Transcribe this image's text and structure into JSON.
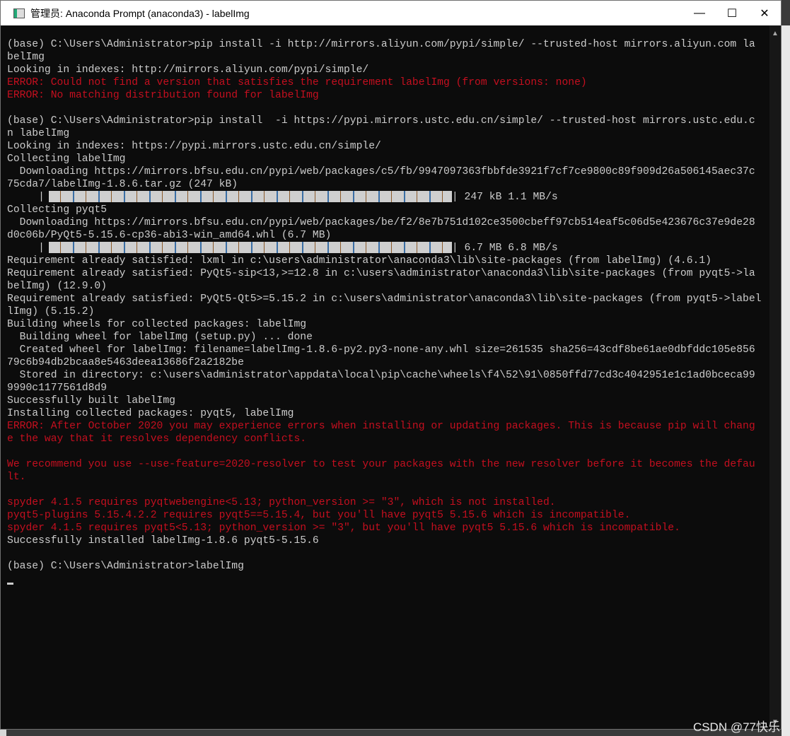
{
  "window": {
    "title": "管理员: Anaconda Prompt (anaconda3) - labelImg",
    "minimize": "—",
    "maximize": "☐",
    "close": "✕"
  },
  "colors": {
    "background": "#0c0c0c",
    "text": "#cccccc",
    "error": "#c50f1f"
  },
  "terminal": {
    "lines": [
      {
        "text": "(base) C:\\Users\\Administrator>pip install -i http://mirrors.aliyun.com/pypi/simple/ --trusted-host mirrors.aliyun.com la"
      },
      {
        "text": "belImg"
      },
      {
        "text": "Looking in indexes: http://mirrors.aliyun.com/pypi/simple/"
      },
      {
        "text": "ERROR: Could not find a version that satisfies the requirement labelImg (from versions: none)",
        "error": true
      },
      {
        "text": "ERROR: No matching distribution found for labelImg",
        "error": true
      },
      {
        "text": ""
      },
      {
        "text": "(base) C:\\Users\\Administrator>pip install  -i https://pypi.mirrors.ustc.edu.cn/simple/ --trusted-host mirrors.ustc.edu.c"
      },
      {
        "text": "n labelImg"
      },
      {
        "text": "Looking in indexes: https://pypi.mirrors.ustc.edu.cn/simple/"
      },
      {
        "text": "Collecting labelImg"
      },
      {
        "text": "  Downloading https://mirrors.bfsu.edu.cn/pypi/web/packages/c5/fb/9947097363fbbfde3921f7cf7ce9800c89f909d26a506145aec37c"
      },
      {
        "text": "75cda7/labelImg-1.8.6.tar.gz (247 kB)"
      },
      {
        "progress": 100,
        "text": "| 247 kB 1.1 MB/s"
      },
      {
        "text": "Collecting pyqt5"
      },
      {
        "text": "  Downloading https://mirrors.bfsu.edu.cn/pypi/web/packages/be/f2/8e7b751d102ce3500cbeff97cb514eaf5c06d5e423676c37e9de28"
      },
      {
        "text": "d0c06b/PyQt5-5.15.6-cp36-abi3-win_amd64.whl (6.7 MB)"
      },
      {
        "progress": 100,
        "text": "| 6.7 MB 6.8 MB/s"
      },
      {
        "text": "Requirement already satisfied: lxml in c:\\users\\administrator\\anaconda3\\lib\\site-packages (from labelImg) (4.6.1)"
      },
      {
        "text": "Requirement already satisfied: PyQt5-sip<13,>=12.8 in c:\\users\\administrator\\anaconda3\\lib\\site-packages (from pyqt5->la"
      },
      {
        "text": "belImg) (12.9.0)"
      },
      {
        "text": "Requirement already satisfied: PyQt5-Qt5>=5.15.2 in c:\\users\\administrator\\anaconda3\\lib\\site-packages (from pyqt5->label"
      },
      {
        "text": "lImg) (5.15.2)"
      },
      {
        "text": "Building wheels for collected packages: labelImg"
      },
      {
        "text": "  Building wheel for labelImg (setup.py) ... done"
      },
      {
        "text": "  Created wheel for labelImg: filename=labelImg-1.8.6-py2.py3-none-any.whl size=261535 sha256=43cdf8be61ae0dbfddc105e856"
      },
      {
        "text": "79c6b94db2bcaa8e5463deea13686f2a2182be"
      },
      {
        "text": "  Stored in directory: c:\\users\\administrator\\appdata\\local\\pip\\cache\\wheels\\f4\\52\\91\\0850ffd77cd3c4042951e1c1ad0bceca99"
      },
      {
        "text": "9990c1177561d8d9"
      },
      {
        "text": "Successfully built labelImg"
      },
      {
        "text": "Installing collected packages: pyqt5, labelImg"
      },
      {
        "text": "ERROR: After October 2020 you may experience errors when installing or updating packages. This is because pip will chang",
        "error": true
      },
      {
        "text": "e the way that it resolves dependency conflicts.",
        "error": true
      },
      {
        "text": ""
      },
      {
        "text": "We recommend you use --use-feature=2020-resolver to test your packages with the new resolver before it becomes the defau",
        "error": true
      },
      {
        "text": "lt.",
        "error": true
      },
      {
        "text": ""
      },
      {
        "text": "spyder 4.1.5 requires pyqtwebengine<5.13; python_version >= \"3\", which is not installed.",
        "error": true
      },
      {
        "text": "pyqt5-plugins 5.15.4.2.2 requires pyqt5==5.15.4, but you'll have pyqt5 5.15.6 which is incompatible.",
        "error": true
      },
      {
        "text": "spyder 4.1.5 requires pyqt5<5.13; python_version >= \"3\", but you'll have pyqt5 5.15.6 which is incompatible.",
        "error": true
      },
      {
        "text": "Successfully installed labelImg-1.8.6 pyqt5-5.15.6"
      },
      {
        "text": ""
      },
      {
        "text": "(base) C:\\Users\\Administrator>labelImg"
      },
      {
        "cursor": true
      }
    ]
  },
  "watermark": "CSDN @77快乐"
}
